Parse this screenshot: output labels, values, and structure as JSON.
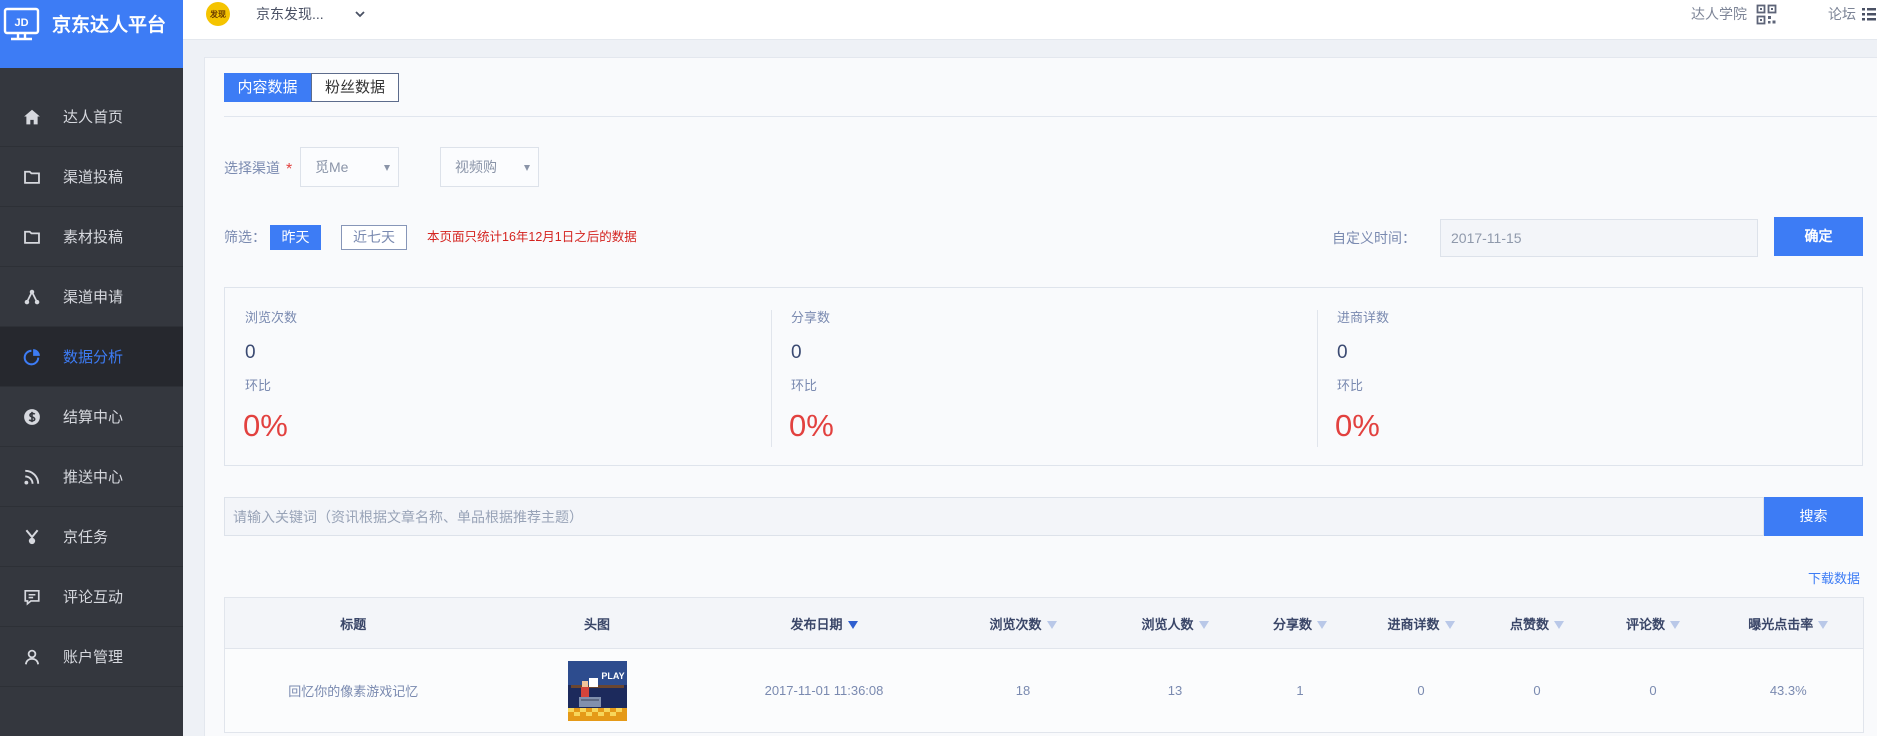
{
  "app": {
    "logo_text": "JD",
    "title": "京东达人平台"
  },
  "header": {
    "avatar_text": "发现",
    "account_name": "京东发现...",
    "academy_label": "达人学院",
    "forum_label": "论坛"
  },
  "sidebar": {
    "active_index": 4,
    "items": [
      {
        "label": "达人首页",
        "icon": "home-icon"
      },
      {
        "label": "渠道投稿",
        "icon": "folder-icon"
      },
      {
        "label": "素材投稿",
        "icon": "folder-icon"
      },
      {
        "label": "渠道申请",
        "icon": "share-nodes-icon"
      },
      {
        "label": "数据分析",
        "icon": "pie-chart-icon"
      },
      {
        "label": "结算中心",
        "icon": "dollar-icon"
      },
      {
        "label": "推送中心",
        "icon": "rss-icon"
      },
      {
        "label": "京任务",
        "icon": "task-icon"
      },
      {
        "label": "评论互动",
        "icon": "comment-icon"
      },
      {
        "label": "账户管理",
        "icon": "user-icon"
      }
    ]
  },
  "tabs": [
    {
      "label": "内容数据",
      "active": true
    },
    {
      "label": "粉丝数据",
      "active": false
    }
  ],
  "filters": {
    "channel_label": "选择渠道",
    "required_mark": "*",
    "channel_select": {
      "value": "觅Me"
    },
    "subchannel_select": {
      "value": "视频购"
    },
    "filter_label": "筛选：",
    "quick_ranges": [
      {
        "label": "昨天",
        "active": true
      },
      {
        "label": "近七天",
        "active": false
      }
    ],
    "notice": "本页面只统计16年12月1日之后的数据",
    "custom_time_label": "自定义时间：",
    "date_value": "2017-11-15",
    "confirm_label": "确定"
  },
  "stats": [
    {
      "label": "浏览次数",
      "value": "0",
      "ratio_label": "环比",
      "ratio": "0%"
    },
    {
      "label": "分享数",
      "value": "0",
      "ratio_label": "环比",
      "ratio": "0%"
    },
    {
      "label": "进商详数",
      "value": "0",
      "ratio_label": "环比",
      "ratio": "0%"
    }
  ],
  "search": {
    "placeholder": "请输入关键词（资讯根据文章名称、单品根据推荐主题）",
    "button_label": "搜索"
  },
  "download_label": "下载数据",
  "table": {
    "headers": [
      {
        "label": "标题",
        "sortable": false
      },
      {
        "label": "头图",
        "sortable": false
      },
      {
        "label": "发布日期",
        "sortable": true,
        "sorted_desc": true
      },
      {
        "label": "浏览次数",
        "sortable": true
      },
      {
        "label": "浏览人数",
        "sortable": true
      },
      {
        "label": "分享数",
        "sortable": true
      },
      {
        "label": "进商详数",
        "sortable": true
      },
      {
        "label": "点赞数",
        "sortable": true
      },
      {
        "label": "评论数",
        "sortable": true
      },
      {
        "label": "曝光点击率",
        "sortable": true
      }
    ],
    "rows": [
      {
        "title": "回忆你的像素游戏记忆",
        "thumbnail_text": "PLAY",
        "publish_date": "2017-11-01 11:36:08",
        "views": "18",
        "visitors": "13",
        "shares": "1",
        "detail_visits": "0",
        "likes": "0",
        "comments": "0",
        "ctr": "43.3%"
      }
    ]
  },
  "colors": {
    "brand": "#3d7cf5",
    "sidebar_bg": "#34373e",
    "sidebar_active_bg": "#26282e",
    "alert": "#e2413f"
  }
}
